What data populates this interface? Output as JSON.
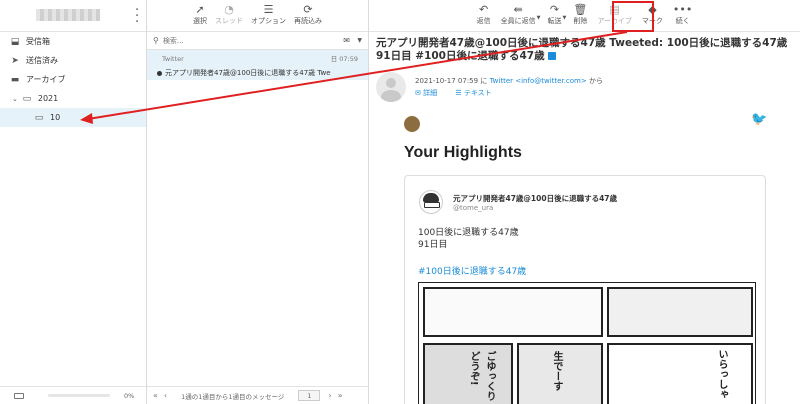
{
  "sidebar": {
    "folders": [
      {
        "label": "受信箱",
        "icon": "inbox-icon",
        "glyph": "☐"
      },
      {
        "label": "送信済み",
        "icon": "sent-icon",
        "glyph": "➤"
      },
      {
        "label": "アーカイブ",
        "icon": "archive-icon",
        "glyph": "▬"
      },
      {
        "label": "2021",
        "icon": "folder-icon",
        "glyph": "▭",
        "expander": "⌄"
      },
      {
        "label": "10",
        "icon": "folder-icon",
        "glyph": "▭"
      }
    ],
    "quota": "0%"
  },
  "list_toolbar": {
    "select": "選択",
    "thread": "スレッド",
    "options": "オプション",
    "refresh": "再読込み"
  },
  "search": {
    "placeholder": "検索..."
  },
  "messages": [
    {
      "from": "Twitter",
      "date": "日 07:59",
      "subject": "元アプリ開発者47歳@100日後に退職する47歳 Twe"
    }
  ],
  "list_footer": {
    "page_info": "1通の1通目から1通目のメッセージ",
    "page": "1"
  },
  "msg_toolbar": {
    "reply": "返信",
    "reply_all": "全員に返信",
    "forward": "転送",
    "delete": "削除",
    "archive": "アーカイブ",
    "mark": "マーク",
    "more": "続く"
  },
  "message": {
    "subject": "元アプリ開発者47歳@100日後に退職する47歳 Tweeted: 100日後に退職する47歳 91日目 #100日後に退職する47歳",
    "date": "2021-10-17 07:59",
    "from_pre": "に",
    "from": "Twitter <info@twitter.com>",
    "from_post": "から",
    "details": "詳細",
    "text": "テキスト"
  },
  "body": {
    "heading": "Your Highlights",
    "tweet_name": "元アプリ開発者47歳@100日後に退職する47歳",
    "tweet_handle": "@tome_ura",
    "tweet_line1": "100日後に退職する47歳",
    "tweet_line2": "91日目",
    "tweet_tag": "#100日後に退職する47歳",
    "manga_text1": "ごゆっくり",
    "manga_text2": "どうぞ!",
    "manga_text3": "生でーす",
    "manga_text4": "いらっしゃ"
  }
}
